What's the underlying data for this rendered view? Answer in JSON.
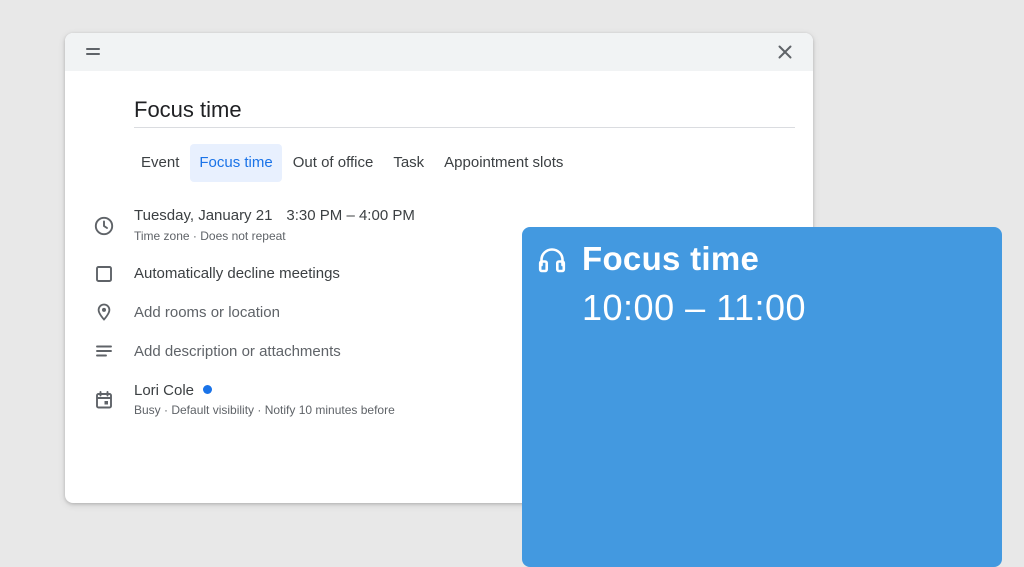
{
  "dialog": {
    "title_value": "Focus time",
    "tabs": [
      {
        "label": "Event"
      },
      {
        "label": "Focus time"
      },
      {
        "label": "Out of office"
      },
      {
        "label": "Task"
      },
      {
        "label": "Appointment slots"
      }
    ],
    "active_tab": "Focus time",
    "datetime": {
      "date": "Tuesday, January 21",
      "time": "3:30 PM – 4:00 PM",
      "sub": "Time zone · Does not repeat"
    },
    "decline": {
      "label": "Automatically decline meetings",
      "checked": false
    },
    "location": {
      "placeholder": "Add rooms or location"
    },
    "description": {
      "placeholder": "Add description or attachments"
    },
    "calendar": {
      "owner": "Lori Cole",
      "sub": "Busy · Default visibility · Notify 10 minutes before",
      "dot_color": "#1a73e8"
    }
  },
  "icons": {
    "drag": "drag-handle-icon",
    "close": "close-icon",
    "clock": "clock-icon",
    "checkbox": "checkbox-icon",
    "location": "location-pin-icon",
    "description": "notes-icon",
    "calendar": "calendar-icon",
    "focus": "headphones-icon"
  },
  "focus_card": {
    "title": "Focus time",
    "time": "10:00 – 11:00",
    "color": "#4399e0"
  }
}
